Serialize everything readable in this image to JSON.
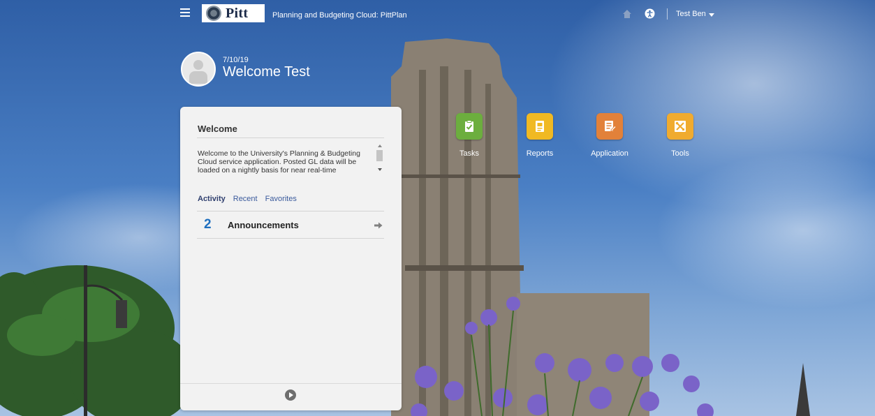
{
  "header": {
    "logo_text": "Pitt",
    "app_title": "Planning and Budgeting Cloud: PittPlan",
    "user_name": "Test Ben",
    "icons": [
      "menu-icon",
      "home-icon",
      "accessibility-icon",
      "chevron-down-icon"
    ]
  },
  "welcome": {
    "date": "7/10/19",
    "greeting": "Welcome Test"
  },
  "panel": {
    "title": "Welcome",
    "message": "Welcome to the University's Planning & Budgeting Cloud service application.  Posted GL data will be loaded on a nightly basis for near real-time",
    "tabs": [
      {
        "label": "Activity",
        "active": true
      },
      {
        "label": "Recent",
        "active": false
      },
      {
        "label": "Favorites",
        "active": false
      }
    ],
    "announcements": {
      "count": "2",
      "label": "Announcements"
    }
  },
  "cards": [
    {
      "label": "Tasks",
      "color": "#6cae3e",
      "icon": "task-check-icon"
    },
    {
      "label": "Reports",
      "color": "#f0b923",
      "icon": "report-icon"
    },
    {
      "label": "Application",
      "color": "#e2813a",
      "icon": "application-icon"
    },
    {
      "label": "Tools",
      "color": "#f0ab2f",
      "icon": "tools-icon"
    }
  ]
}
